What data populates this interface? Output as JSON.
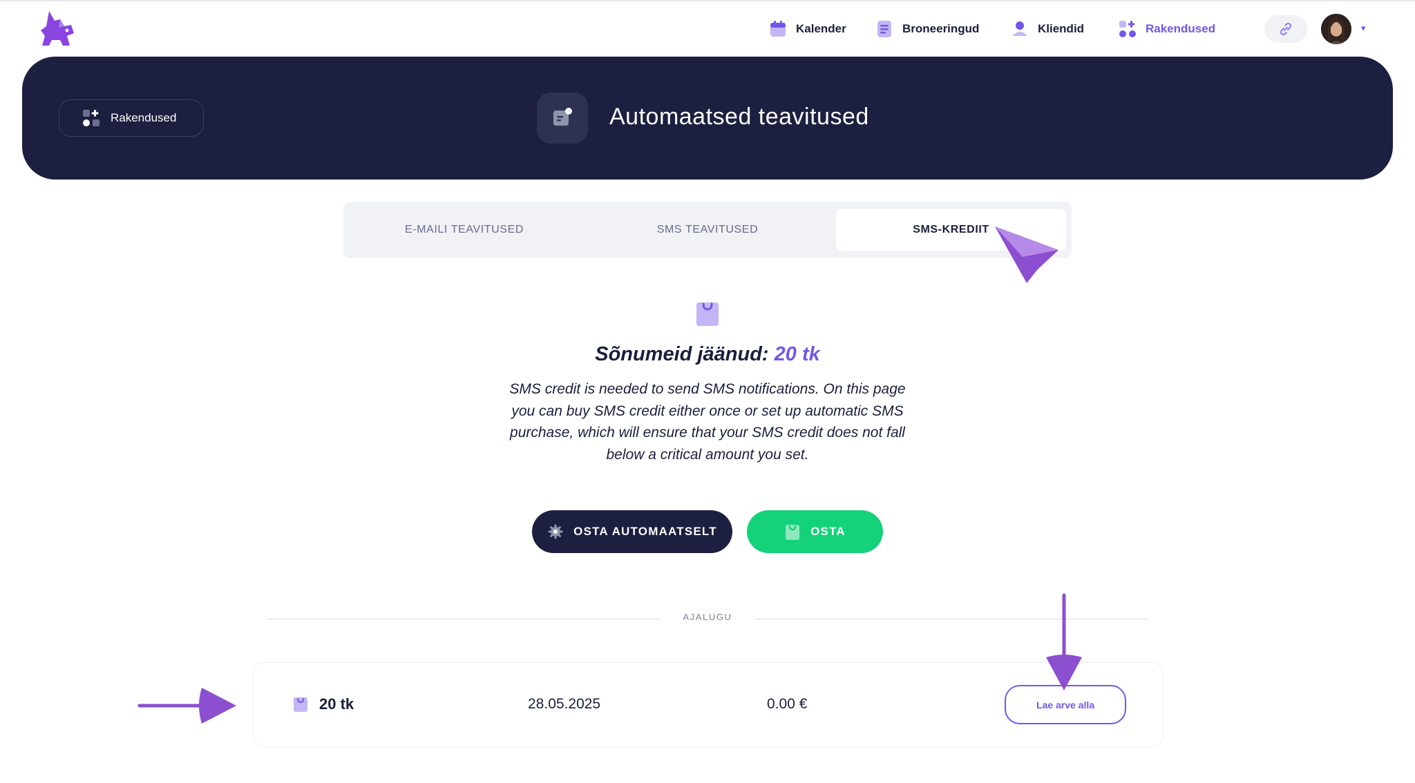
{
  "nav": {
    "items": [
      {
        "label": "Kalender",
        "icon": "calendar-icon"
      },
      {
        "label": "Broneeringud",
        "icon": "bookings-list-icon"
      },
      {
        "label": "Kliendid",
        "icon": "clients-icon"
      },
      {
        "label": "Rakendused",
        "icon": "apps-grid-icon",
        "active": true
      }
    ],
    "link_icon": "link-icon",
    "menu_caret": "▾"
  },
  "hero": {
    "back_label": "Rakendused",
    "title": "Automaatsed teavitused",
    "icon": "notification-chat-icon"
  },
  "tabs": [
    {
      "label": "E-MAILI TEAVITUSED"
    },
    {
      "label": "SMS TEAVITUSED"
    },
    {
      "label": "SMS-KREDIIT",
      "active": true
    }
  ],
  "credits": {
    "title_prefix": "Sõnumeid jäänud:",
    "title_value": "20 tk",
    "description": "SMS credit is needed to send SMS notifications. On this page you can buy SMS credit either once or set up automatic SMS purchase, which will ensure that your SMS credit does not fall below a critical amount you set.",
    "buy_auto_label": "OSTA AUTOMAATSELT",
    "buy_label": "OSTA"
  },
  "history": {
    "label": "AJALUGU",
    "rows": [
      {
        "quantity": "20 tk",
        "date": "28.05.2025",
        "amount": "0.00 €",
        "action_label": "Lae arve alla"
      }
    ]
  },
  "colors": {
    "accent": "#7356e8",
    "dark": "#1c1f3f",
    "green": "#13d27a",
    "annotation": "#8c4fd0"
  }
}
